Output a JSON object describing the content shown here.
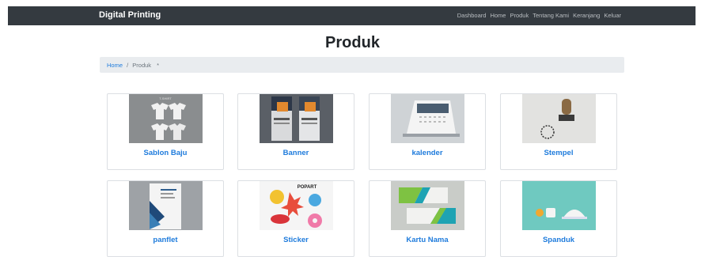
{
  "navbar": {
    "brand": "Digital Printing",
    "links": [
      "Dashboard",
      "Home",
      "Produk",
      "Tentang Kami",
      "Keranjang",
      "Keluar"
    ]
  },
  "page": {
    "title": "Produk"
  },
  "breadcrumb": {
    "home": "Home",
    "separator": "/",
    "current": "Produk",
    "extra": "*"
  },
  "products": [
    {
      "name": "Sablon Baju",
      "thumb_text": "T-SHIRT"
    },
    {
      "name": "Banner"
    },
    {
      "name": "kalender"
    },
    {
      "name": "Stempel"
    },
    {
      "name": "panflet"
    },
    {
      "name": "Sticker",
      "thumb_text": "POPART"
    },
    {
      "name": "Kartu Nama"
    },
    {
      "name": "Spanduk"
    }
  ],
  "colors": {
    "navbar": "#343a40",
    "link": "#1e7bdc",
    "breadcrumb_bg": "#e9ecef"
  }
}
